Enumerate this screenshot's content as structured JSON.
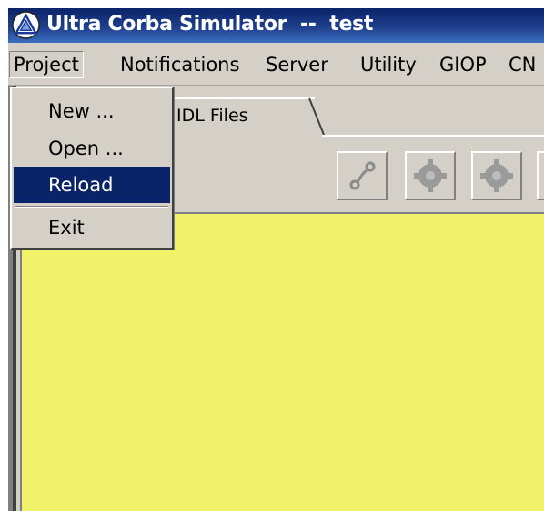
{
  "window": {
    "title": "Ultra Corba Simulator  --  test",
    "icon": "triangle-logo-icon"
  },
  "menubar": {
    "items": [
      {
        "label": "Project"
      },
      {
        "label": "Notifications"
      },
      {
        "label": "Server"
      },
      {
        "label": "Utility"
      },
      {
        "label": "GIOP"
      },
      {
        "label": "CN"
      }
    ]
  },
  "project_menu": {
    "items": [
      {
        "label": "New ..."
      },
      {
        "label": "Open ..."
      },
      {
        "label": "Reload",
        "selected": true
      },
      {
        "label": "Exit"
      }
    ],
    "selected_color": "#0a246a"
  },
  "tabs": [
    {
      "label": "IDL Files"
    }
  ],
  "toolbar": {
    "buttons": [
      {
        "icon": "link-icon"
      },
      {
        "icon": "gear-icon"
      },
      {
        "icon": "gear-icon"
      },
      {
        "icon": "partial-button"
      }
    ]
  },
  "colors": {
    "titlebar": "#0a246a",
    "workspace": "#f2f26a",
    "chrome": "#d4d0c8"
  }
}
